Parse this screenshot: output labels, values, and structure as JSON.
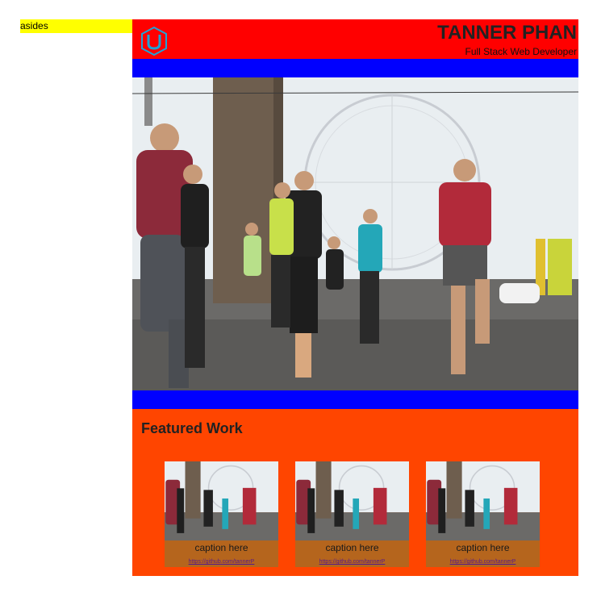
{
  "aside": {
    "label": "asides"
  },
  "header": {
    "logo_icon": "udacity-logo-icon",
    "name": "TANNER PHAN",
    "subtitle": "Full Stack Web Developer"
  },
  "hero": {
    "image_alt": "runners-photo"
  },
  "featured": {
    "title": "Featured Work",
    "cards": [
      {
        "caption": "caption here",
        "link": "https://github.com/tannerP"
      },
      {
        "caption": "caption here",
        "link": "https://github.com/tannerP"
      },
      {
        "caption": "caption here",
        "link": "https://github.com/tannerP"
      }
    ]
  },
  "colors": {
    "aside_bg": "#ffff00",
    "header_bg": "#ff0000",
    "bar_bg": "#0000ff",
    "featured_bg": "#ff4500",
    "logo": "#1fa3d6"
  }
}
